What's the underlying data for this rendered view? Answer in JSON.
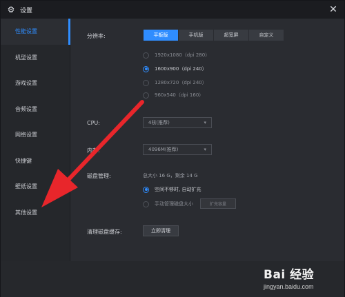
{
  "window": {
    "title": "设置"
  },
  "sidebar": {
    "items": [
      {
        "label": "性能设置"
      },
      {
        "label": "机型设置"
      },
      {
        "label": "游戏设置"
      },
      {
        "label": "音频设置"
      },
      {
        "label": "网络设置"
      },
      {
        "label": "快捷键"
      },
      {
        "label": "壁纸设置"
      },
      {
        "label": "其他设置"
      }
    ]
  },
  "resolution": {
    "label": "分辨率:",
    "tabs": [
      {
        "label": "平板版"
      },
      {
        "label": "手机版"
      },
      {
        "label": "超宽屏"
      },
      {
        "label": "自定义"
      }
    ],
    "options": [
      {
        "label": "1920x1080（dpi 280）"
      },
      {
        "label": "1600x900（dpi 240）"
      },
      {
        "label": "1280x720（dpi 240）"
      },
      {
        "label": "960x540（dpi 160）"
      }
    ]
  },
  "cpu": {
    "label": "CPU:",
    "value": "4核(推荐)"
  },
  "memory": {
    "label": "内存:",
    "value": "4096M(推荐)"
  },
  "disk": {
    "label": "磁盘管理:",
    "info": "总大小 16 G，剩余 14 G",
    "option_auto": "空间不够时, 自动扩充",
    "option_manual": "手动管理磁盘大小",
    "expand_button": "扩充容量"
  },
  "cache": {
    "label": "清理磁盘缓存:",
    "button": "立即清理"
  },
  "watermark": {
    "logo": "Bai 经验",
    "url": "jingyan.baidu.com"
  },
  "colors": {
    "accent": "#2f8dff",
    "arrow": "#e8262b",
    "background": "#2a2c31"
  }
}
